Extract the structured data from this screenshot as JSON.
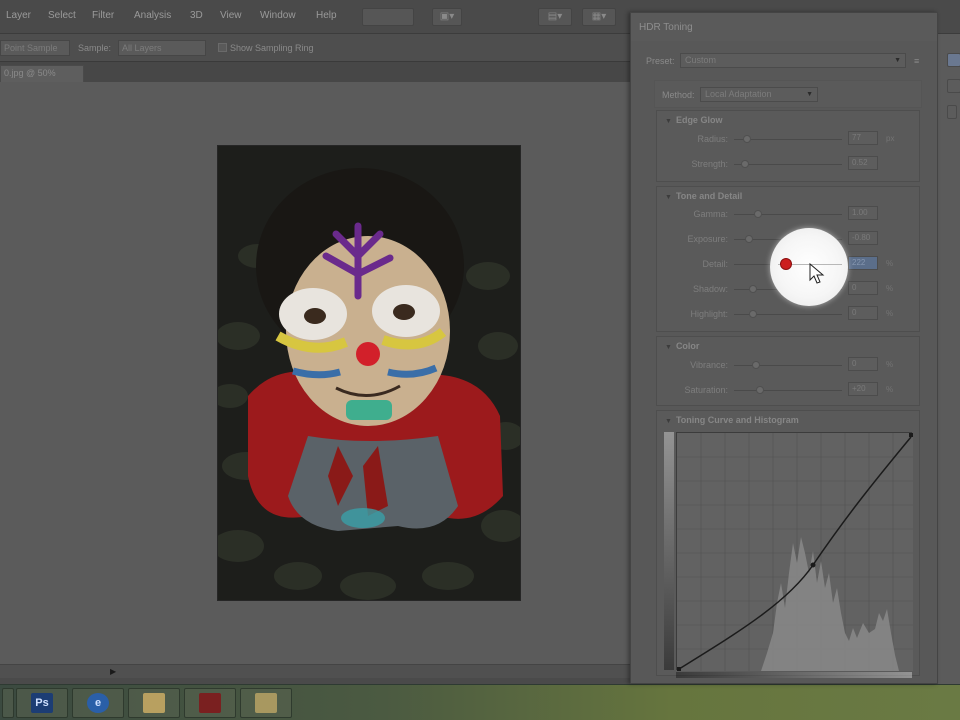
{
  "menu": {
    "items": [
      "Layer",
      "Select",
      "Filter",
      "Analysis",
      "3D",
      "View",
      "Window",
      "Help"
    ]
  },
  "options_bar": {
    "sample_size_value": "Point Sample",
    "sample_label": "Sample:",
    "sample_value": "All Layers",
    "show_ring_label": "Show Sampling Ring"
  },
  "document": {
    "tab_label": "0.jpg @ 50% (RGB/8*) ×"
  },
  "hdr_dialog": {
    "title": "HDR Toning",
    "preset_label": "Preset:",
    "preset_value": "Custom",
    "method_label": "Method:",
    "method_value": "Local Adaptation",
    "edge_glow": {
      "title": "Edge Glow",
      "radius_label": "Radius:",
      "radius_value": "77",
      "radius_unit": "px",
      "strength_label": "Strength:",
      "strength_value": "0.52"
    },
    "tone_detail": {
      "title": "Tone and Detail",
      "gamma_label": "Gamma:",
      "gamma_value": "1.00",
      "exposure_label": "Exposure:",
      "exposure_value": "-0.80",
      "detail_label": "Detail:",
      "detail_value": "222",
      "detail_unit": "%",
      "shadow_label": "Shadow:",
      "shadow_value": "0",
      "shadow_unit": "%",
      "highlight_label": "Highlight:",
      "highlight_value": "0",
      "highlight_unit": "%"
    },
    "color": {
      "title": "Color",
      "vibrance_label": "Vibrance:",
      "vibrance_value": "0",
      "vibrance_unit": "%",
      "saturation_label": "Saturation:",
      "saturation_value": "+20",
      "saturation_unit": "%"
    },
    "curve_section": {
      "title": "Toning Curve and Histogram"
    }
  },
  "slider_levels": {
    "radius": 0.12,
    "strength": 0.1,
    "gamma": 0.22,
    "exposure": 0.14,
    "detail": 0.48,
    "shadow": 0.18,
    "highlight": 0.18,
    "vibrance": 0.2,
    "saturation": 0.24
  },
  "colors": {
    "panel": "#585858",
    "highlight_spot": "#ffffff",
    "cursor_dot": "#cc1e1e",
    "selection": "#5b6e8a"
  }
}
